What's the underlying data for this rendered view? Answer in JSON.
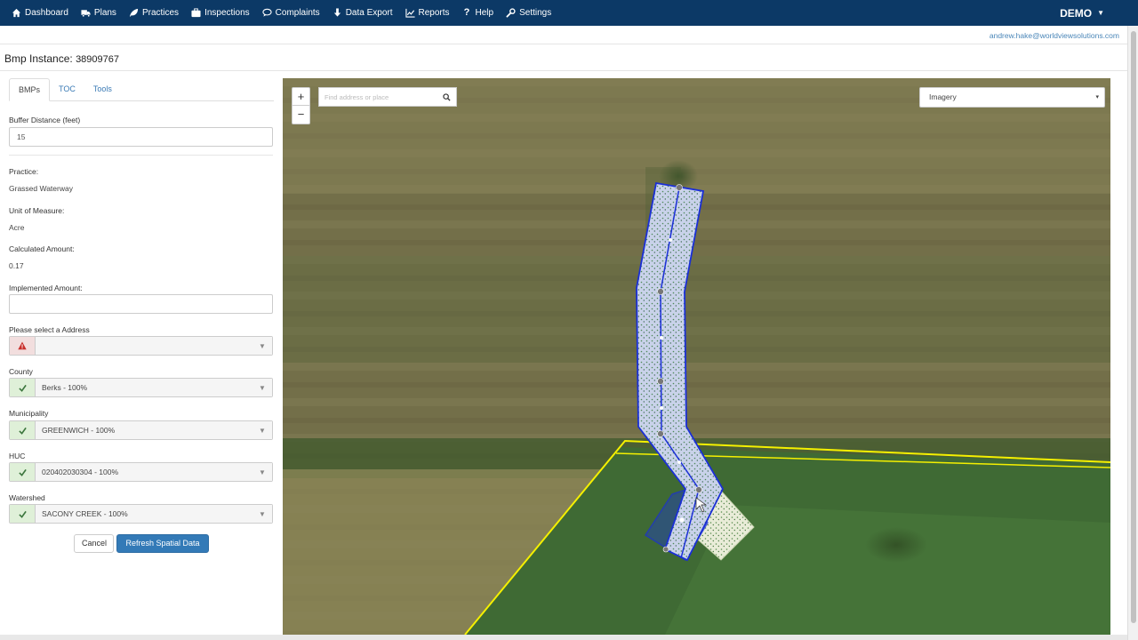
{
  "nav": {
    "items": [
      {
        "label": "Dashboard",
        "icon": "home-icon"
      },
      {
        "label": "Plans",
        "icon": "truck-icon"
      },
      {
        "label": "Practices",
        "icon": "leaf-icon"
      },
      {
        "label": "Inspections",
        "icon": "briefcase-icon"
      },
      {
        "label": "Complaints",
        "icon": "comments-icon"
      },
      {
        "label": "Data Export",
        "icon": "download-icon"
      },
      {
        "label": "Reports",
        "icon": "chart-icon"
      },
      {
        "label": "Help",
        "icon": "question-icon"
      },
      {
        "label": "Settings",
        "icon": "wrench-icon"
      }
    ],
    "account": "DEMO",
    "account_caret": "▼"
  },
  "user_email": "andrew.hake@worldviewsolutions.com",
  "page": {
    "title": "Bmp Instance:",
    "instance_id": "38909767"
  },
  "tabs": [
    "BMPs",
    "TOC",
    "Tools"
  ],
  "form": {
    "buffer_label": "Buffer Distance (feet)",
    "buffer_value": "15",
    "practice_label": "Practice:",
    "practice_value": "Grassed Waterway",
    "unit_label": "Unit of Measure:",
    "unit_value": "Acre",
    "calc_label": "Calculated Amount:",
    "calc_value": "0.17",
    "impl_label": "Implemented Amount:",
    "impl_value": "",
    "address_label": "Please select a Address",
    "address_value": "",
    "county_label": "County",
    "county_value": "Berks - 100%",
    "muni_label": "Municipality",
    "muni_value": "GREENWICH - 100%",
    "huc_label": "HUC",
    "huc_value": "020402030304 - 100%",
    "watershed_label": "Watershed",
    "watershed_value": "SACONY CREEK - 100%",
    "cancel_label": "Cancel",
    "refresh_label": "Refresh Spatial Data"
  },
  "map": {
    "zoom_in": "+",
    "zoom_out": "−",
    "search_placeholder": "Find address or place",
    "layer_value": "Imagery",
    "layer_caret": "▾"
  },
  "colors": {
    "navbar": "#0c3966",
    "primary": "#337ab7",
    "link": "#3a7ab5",
    "parcel_line": "#f5f000",
    "bmp_outline": "#1a2fd6"
  }
}
